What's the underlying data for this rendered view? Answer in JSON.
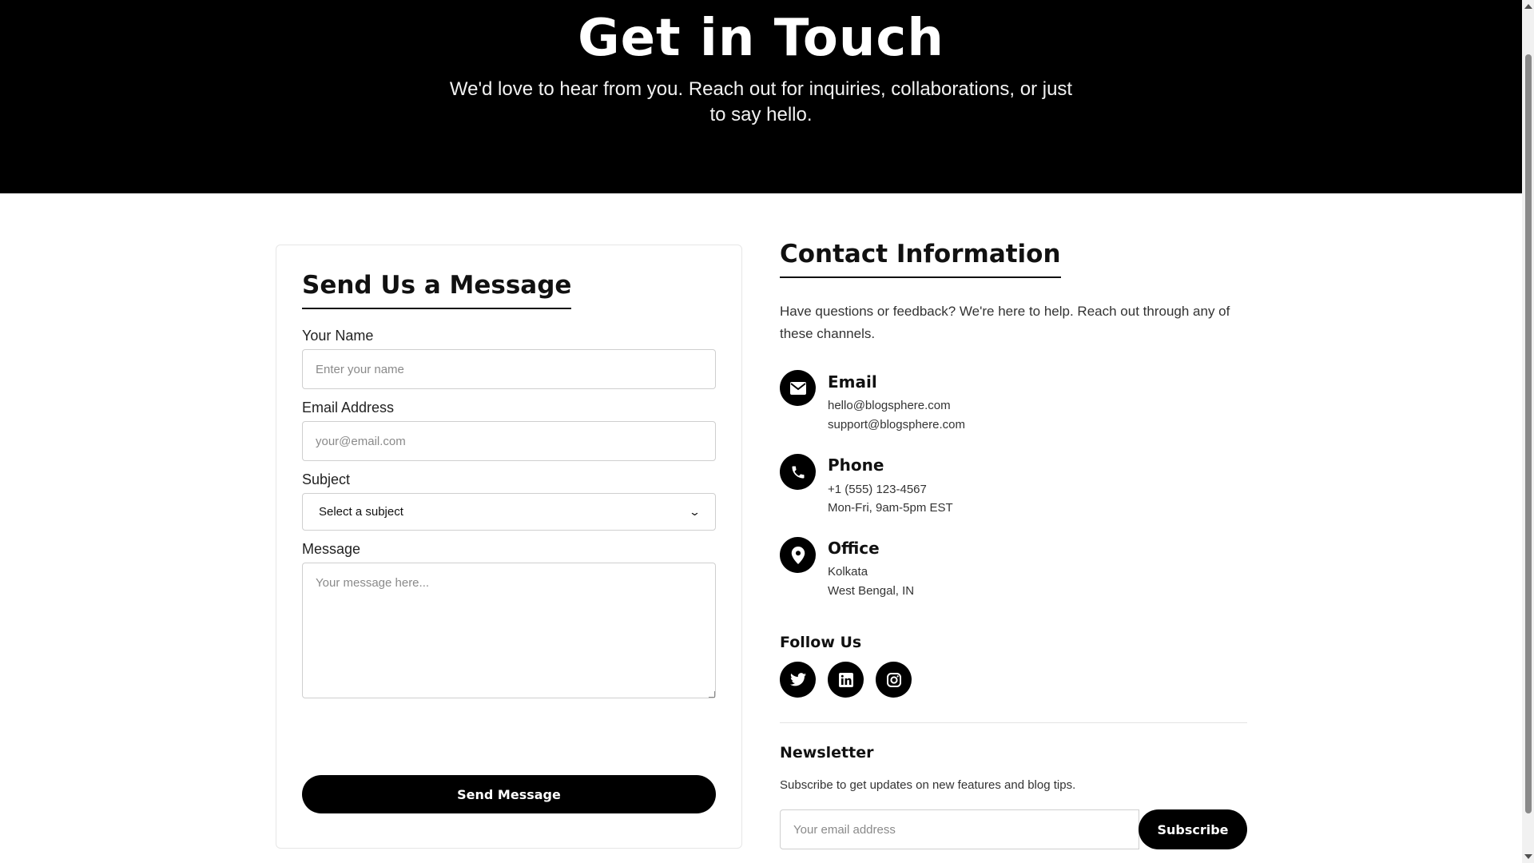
{
  "hero": {
    "title": "Get in Touch",
    "subtitle": "We'd love to hear from you. Reach out for inquiries, collaborations, or just to say hello."
  },
  "form": {
    "title": "Send Us a Message",
    "name_label": "Your Name",
    "name_placeholder": "Enter your name",
    "email_label": "Email Address",
    "email_placeholder": "your@email.com",
    "subject_label": "Subject",
    "subject_selected": "Select a subject",
    "message_label": "Message",
    "message_placeholder": "Your message here...",
    "submit_label": "Send Message"
  },
  "contact": {
    "title": "Contact Information",
    "intro": "Have questions or feedback? We're here to help. Reach out through any of these channels.",
    "channels": [
      {
        "icon": "envelope-icon",
        "heading": "Email",
        "lines": [
          "hello@blogsphere.com",
          "support@blogsphere.com"
        ]
      },
      {
        "icon": "phone-icon",
        "heading": "Phone",
        "lines": [
          "+1 (555) 123-4567",
          "Mon-Fri, 9am-5pm EST"
        ]
      },
      {
        "icon": "map-pin-icon",
        "heading": "Office",
        "lines": [
          "Kolkata",
          "West Bengal, IN"
        ]
      }
    ]
  },
  "follow": {
    "title": "Follow Us",
    "socials": [
      "twitter-icon",
      "linkedin-icon",
      "instagram-icon"
    ]
  },
  "newsletter": {
    "title": "Newsletter",
    "text": "Subscribe to get updates on new features and blog tips.",
    "placeholder": "Your email address",
    "button_label": "Subscribe"
  },
  "colors": {
    "primary": "#000000",
    "background": "#ffffff",
    "border": "#cfcfcf"
  }
}
